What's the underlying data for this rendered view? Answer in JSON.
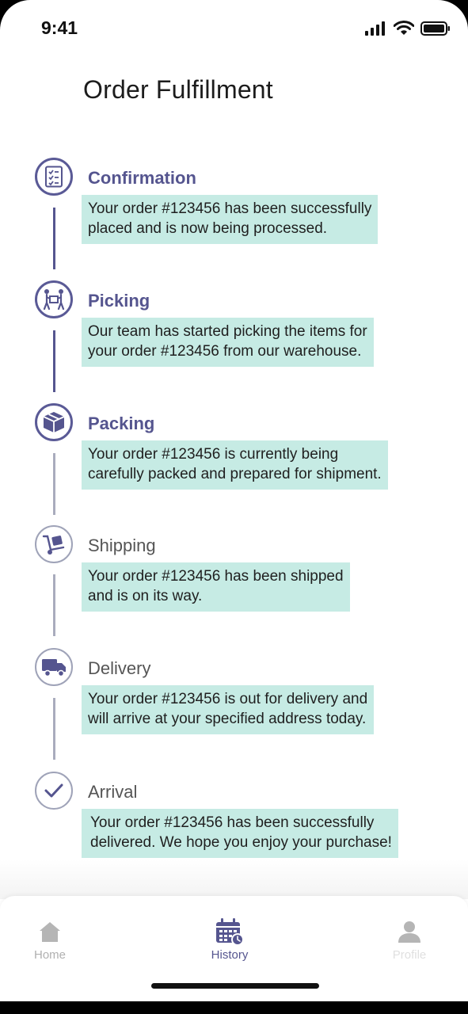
{
  "status": {
    "time": "9:41"
  },
  "page": {
    "title": "Order Fulfillment"
  },
  "steps": [
    {
      "title": "Confirmation",
      "icon": "checklist-icon",
      "state": "done",
      "description": "Your order #123456 has been successfully\nplaced and is now being processed."
    },
    {
      "title": "Picking",
      "icon": "people-carry-icon",
      "state": "done",
      "description": "Our team has started picking the items for\nyour order #123456 from our warehouse."
    },
    {
      "title": "Packing",
      "icon": "box-icon",
      "state": "done",
      "description": "Your order #123456 is currently being\ncarefully packed and prepared for shipment."
    },
    {
      "title": "Shipping",
      "icon": "dolly-icon",
      "state": "todo",
      "description": "Your order #123456 has been shipped\nand is on its way."
    },
    {
      "title": "Delivery",
      "icon": "truck-icon",
      "state": "todo",
      "description": "Your order #123456 is out for delivery and\nwill arrive at your specified address today."
    },
    {
      "title": "Arrival",
      "icon": "checkmark-icon",
      "state": "todo",
      "description": "Your order #123456 has been successfully\ndelivered. We hope you enjoy your purchase!"
    }
  ],
  "nav": {
    "home": "Home",
    "history": "History",
    "profile": "Profile"
  },
  "colors": {
    "accent": "#55558f",
    "inactive_step": "#9fa3b8",
    "highlight": "#c6ebe4"
  }
}
